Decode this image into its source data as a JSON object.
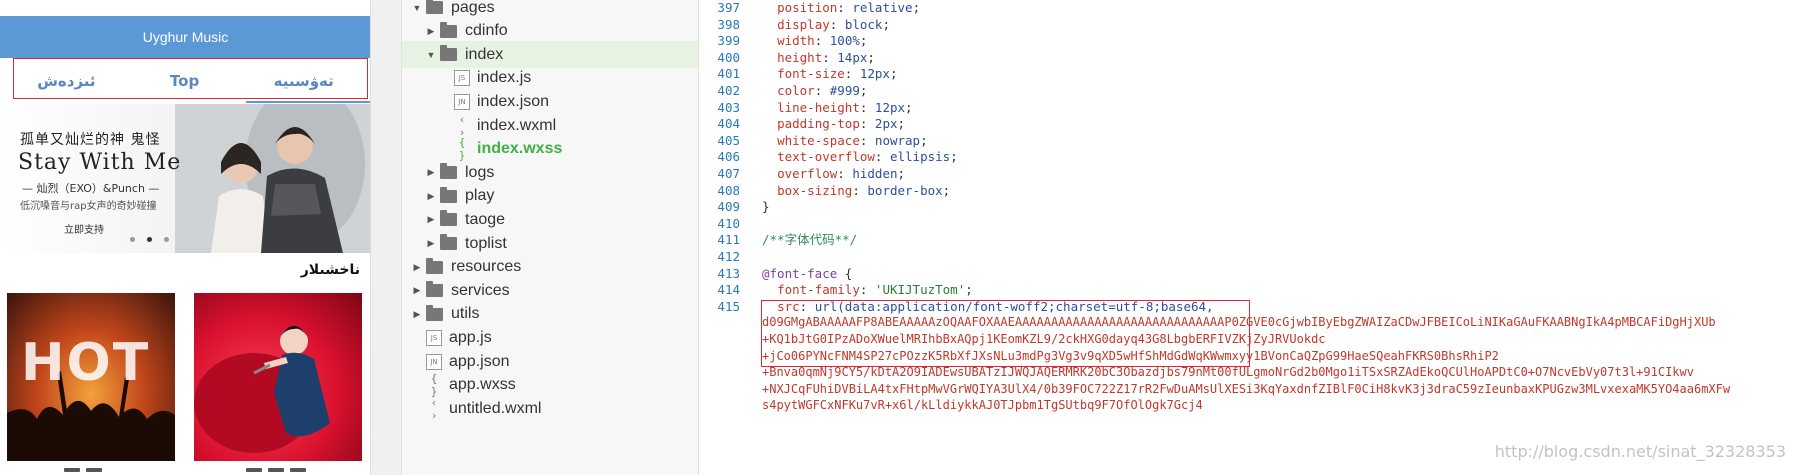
{
  "phone": {
    "title": "Uyghur Music",
    "tabs": [
      "ئىزدەش",
      "Top",
      "تەۋسىيە"
    ],
    "banner": {
      "line1": "孤单又灿烂的神 鬼怪",
      "line2": "Stay With Me",
      "line3": "— 灿烈（EXO）&Punch —",
      "line4": "低沉嗓音与rap女声的奇妙碰撞",
      "line5": "立即支持"
    },
    "section_title": "ناخشىلار",
    "album1_text": "HOT"
  },
  "tree": {
    "items": [
      {
        "name": "pages",
        "type": "folder",
        "depth": 0,
        "expanded": true
      },
      {
        "name": "cdinfo",
        "type": "folder",
        "depth": 1,
        "expanded": false
      },
      {
        "name": "index",
        "type": "folder",
        "depth": 1,
        "expanded": true
      },
      {
        "name": "index.js",
        "type": "file",
        "icon": "JS",
        "depth": 2
      },
      {
        "name": "index.json",
        "type": "file",
        "icon": "JN",
        "depth": 2
      },
      {
        "name": "index.wxml",
        "type": "file",
        "icon": "‹ ›",
        "depth": 2
      },
      {
        "name": "index.wxss",
        "type": "file",
        "icon": "{ }",
        "depth": 2,
        "active": true
      },
      {
        "name": "logs",
        "type": "folder",
        "depth": 1,
        "expanded": false
      },
      {
        "name": "play",
        "type": "folder",
        "depth": 1,
        "expanded": false
      },
      {
        "name": "taoge",
        "type": "folder",
        "depth": 1,
        "expanded": false
      },
      {
        "name": "toplist",
        "type": "folder",
        "depth": 1,
        "expanded": false
      },
      {
        "name": "resources",
        "type": "folder",
        "depth": 0,
        "expanded": false
      },
      {
        "name": "services",
        "type": "folder",
        "depth": 0,
        "expanded": false
      },
      {
        "name": "utils",
        "type": "folder",
        "depth": 0,
        "expanded": false
      },
      {
        "name": "app.js",
        "type": "file",
        "icon": "JS",
        "depth": 0
      },
      {
        "name": "app.json",
        "type": "file",
        "icon": "JN",
        "depth": 0
      },
      {
        "name": "app.wxss",
        "type": "file",
        "icon": "{ }",
        "depth": 0
      },
      {
        "name": "untitled.wxml",
        "type": "file",
        "icon": "‹ ›",
        "depth": 0
      }
    ]
  },
  "editor": {
    "lines": [
      {
        "n": "397",
        "prop": "position",
        "val": "relative"
      },
      {
        "n": "398",
        "prop": "display",
        "val": "block"
      },
      {
        "n": "399",
        "prop": "width",
        "val": "100%"
      },
      {
        "n": "400",
        "prop": "height",
        "val": "14px"
      },
      {
        "n": "401",
        "prop": "font-size",
        "val": "12px"
      },
      {
        "n": "402",
        "prop": "color",
        "val": "#999"
      },
      {
        "n": "403",
        "prop": "line-height",
        "val": "12px"
      },
      {
        "n": "404",
        "prop": "padding-top",
        "val": "2px"
      },
      {
        "n": "405",
        "prop": "white-space",
        "val": "nowrap"
      },
      {
        "n": "406",
        "prop": "text-overflow",
        "val": "ellipsis"
      },
      {
        "n": "407",
        "prop": "overflow",
        "val": "hidden"
      },
      {
        "n": "408",
        "prop": "box-sizing",
        "val": "border-box"
      }
    ],
    "line409": {
      "n": "409",
      "text": "}"
    },
    "line410": {
      "n": "410",
      "text": ""
    },
    "line411": {
      "n": "411",
      "text": "/**字体代码**/"
    },
    "line412": {
      "n": "412",
      "text": ""
    },
    "line413": {
      "n": "413",
      "at": "@font-face",
      "rest": " {"
    },
    "line414": {
      "n": "414",
      "prop": "font-family",
      "str": "'UKIJTuzTom'"
    },
    "line415": {
      "n": "415",
      "prop": "src",
      "val": "url(data:application/font-woff2;charset=utf-8;base64,"
    },
    "data_lines": [
      "d09GMgABAAAAAFP8ABEAAAAAzOQAAFOXAAEAAAAAAAAAAAAAAAAAAAAAAAAAAAAAP0ZGVE0cGjwbIByEbgZWAIZaCDwJFBEICoLiNIKaGAuFKAABNgIkA4pMBCAFiDgHjXUb",
      "+KQ1bJtG0IPzADoXWuelMRIhbBxAQpj1KEomKZL9/2ckHXG0dayq43G8LbgbERFIVZKjZyJRVUokdc",
      "+jCo06PYNcFNM4SP27cPOzzK5RbXfJXsNLu3mdPg3Vg3v9qXD5wHfShMdGdWqKWwmxyy1BVonCaQZpG99HaeSQeahFKRS0BhsRhiP2",
      "+Bnva0qmNj9CY5/kDtA2O9IADEwsUBATzIJWQJAQERMRK20bC3Obazdjbs79nMt00fULgmoNrGd2b0Mgo1iTSxSRZAdEkoQCUlHoAPDtC0+O7NcvEbVy07t3l+91CIkwv",
      "+NXJCqFUhiDVBiLA4txFHtpMwVGrWQIYA3UlX4/0b39FOC722Z17rR2FwDuAMsUlXESi3KqYaxdnfZIBlF0CiH8kvK3j3draC59zIeunbaxKPUGzw3MLvxexaMK5YO4aa6mXFw",
      "s4pytWGFCxNFKu7vR+x6l/kLldiykkAJ0TJpbm1TgSUtbq9F7OfOlOgk7Gcj4"
    ]
  },
  "watermark": "http://blog.csdn.net/sinat_32328353"
}
